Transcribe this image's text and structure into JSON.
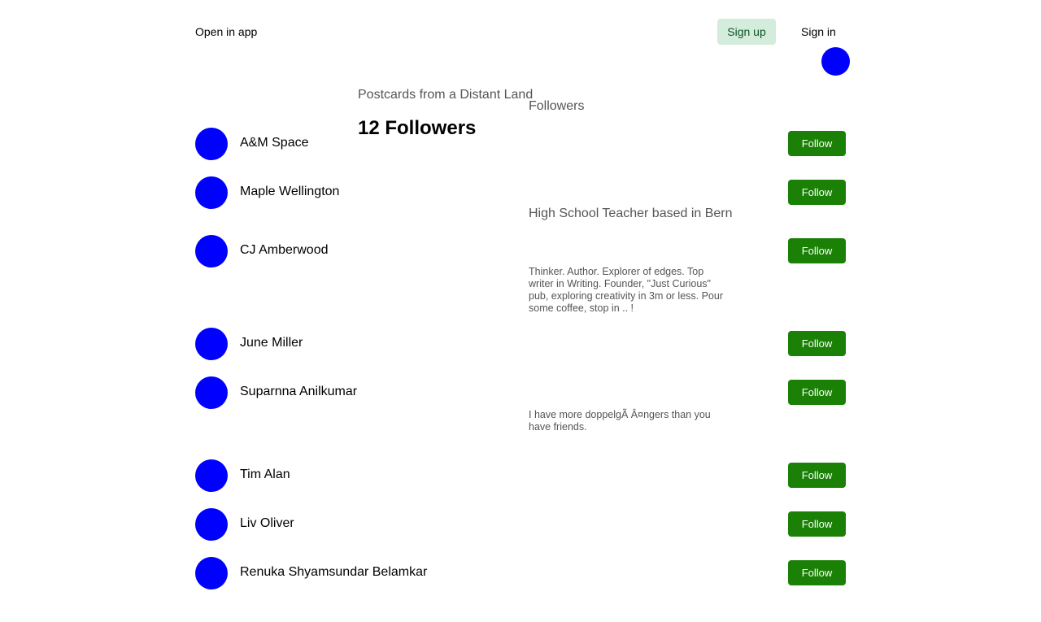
{
  "header": {
    "open_in_app": "Open in app",
    "sign_up": "Sign up",
    "sign_in": "Sign in"
  },
  "publication": {
    "name": "Postcards from a Distant Land",
    "heading": "12 Followers",
    "followers_label": "Followers"
  },
  "followers": [
    {
      "name": "A&M Space",
      "follow_label": "Follow"
    },
    {
      "name": "Maple Wellington",
      "follow_label": "Follow",
      "bio": "High School Teacher based in Bern"
    },
    {
      "name": "CJ Amberwood",
      "follow_label": "Follow",
      "bio": "Thinker. Author. Explorer of edges. Top writer in Writing. Founder, \"Just Curious\" pub, exploring creativity in 3m or less. Pour some coffee, stop in .. !"
    },
    {
      "name": "June Miller",
      "follow_label": "Follow"
    },
    {
      "name": "Suparnna Anilkumar",
      "follow_label": "Follow",
      "bio": "I have more doppelgÃ   Â¤ngers than you have friends."
    },
    {
      "name": "Tim Alan",
      "follow_label": "Follow"
    },
    {
      "name": "Liv Oliver",
      "follow_label": "Follow"
    },
    {
      "name": "Renuka Shyamsundar Belamkar",
      "follow_label": "Follow"
    }
  ]
}
